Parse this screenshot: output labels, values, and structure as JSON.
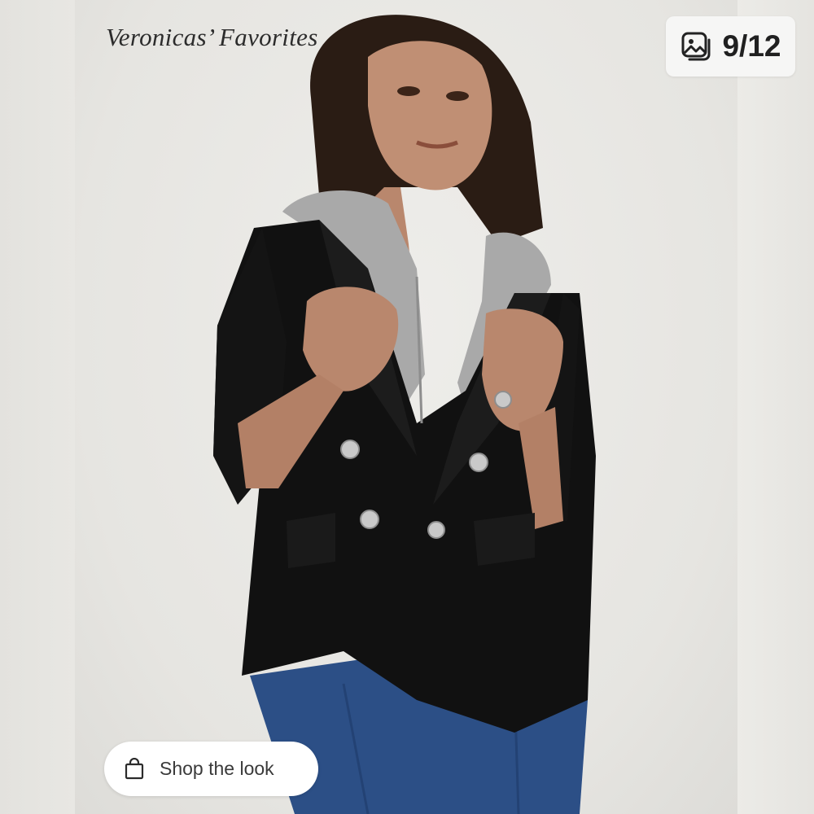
{
  "caption": {
    "text": "Veronicas’ Favorites"
  },
  "gallery": {
    "position_text": "9/12",
    "icon": "image-gallery-icon"
  },
  "shop_button": {
    "label": "Shop the look",
    "icon": "shopping-bag-icon"
  },
  "colors": {
    "background": "#e9e8e4",
    "blazer": "#111111",
    "hood": "#a9a9a9",
    "jeans": "#2c4f86",
    "hair": "#2a1c14",
    "skin": "#b9876d",
    "button_metal": "#c9c9c9",
    "pill_bg": "#ffffff"
  }
}
